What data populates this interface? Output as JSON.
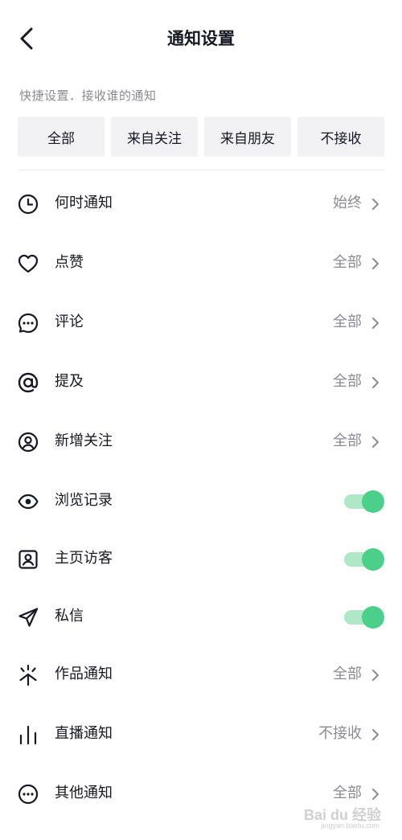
{
  "header": {
    "title": "通知设置",
    "back_icon": "back-arrow-icon"
  },
  "quick": {
    "label": "快捷设置．接收谁的通知",
    "options": [
      "全部",
      "来自关注",
      "来自朋友",
      "不接收"
    ]
  },
  "settings": [
    {
      "icon": "clock-icon",
      "label": "何时通知",
      "value": "始终",
      "control": "chevron"
    },
    {
      "icon": "heart-icon",
      "label": "点赞",
      "value": "全部",
      "control": "chevron"
    },
    {
      "icon": "comment-icon",
      "label": "评论",
      "value": "全部",
      "control": "chevron"
    },
    {
      "icon": "at-icon",
      "label": "提及",
      "value": "全部",
      "control": "chevron"
    },
    {
      "icon": "user-circle-icon",
      "label": "新增关注",
      "value": "全部",
      "control": "chevron"
    },
    {
      "icon": "eye-icon",
      "label": "浏览记录",
      "toggle_on": true,
      "control": "toggle"
    },
    {
      "icon": "profile-visitor-icon",
      "label": "主页访客",
      "toggle_on": true,
      "control": "toggle"
    },
    {
      "icon": "send-icon",
      "label": "私信",
      "toggle_on": true,
      "control": "toggle"
    },
    {
      "icon": "sparkle-icon",
      "label": "作品通知",
      "value": "全部",
      "control": "chevron"
    },
    {
      "icon": "live-bars-icon",
      "label": "直播通知",
      "value": "不接收",
      "control": "chevron"
    },
    {
      "icon": "more-circle-icon",
      "label": "其他通知",
      "value": "全部",
      "control": "chevron"
    }
  ],
  "colors": {
    "toggle_on": "#4bd08c",
    "toggle_track": "#aee8c7",
    "secondary_text": "#8a8b91",
    "button_bg": "#f2f2f4"
  },
  "watermark": {
    "text": "Bai du 经验",
    "sub": "jingyan.baidu.com"
  }
}
